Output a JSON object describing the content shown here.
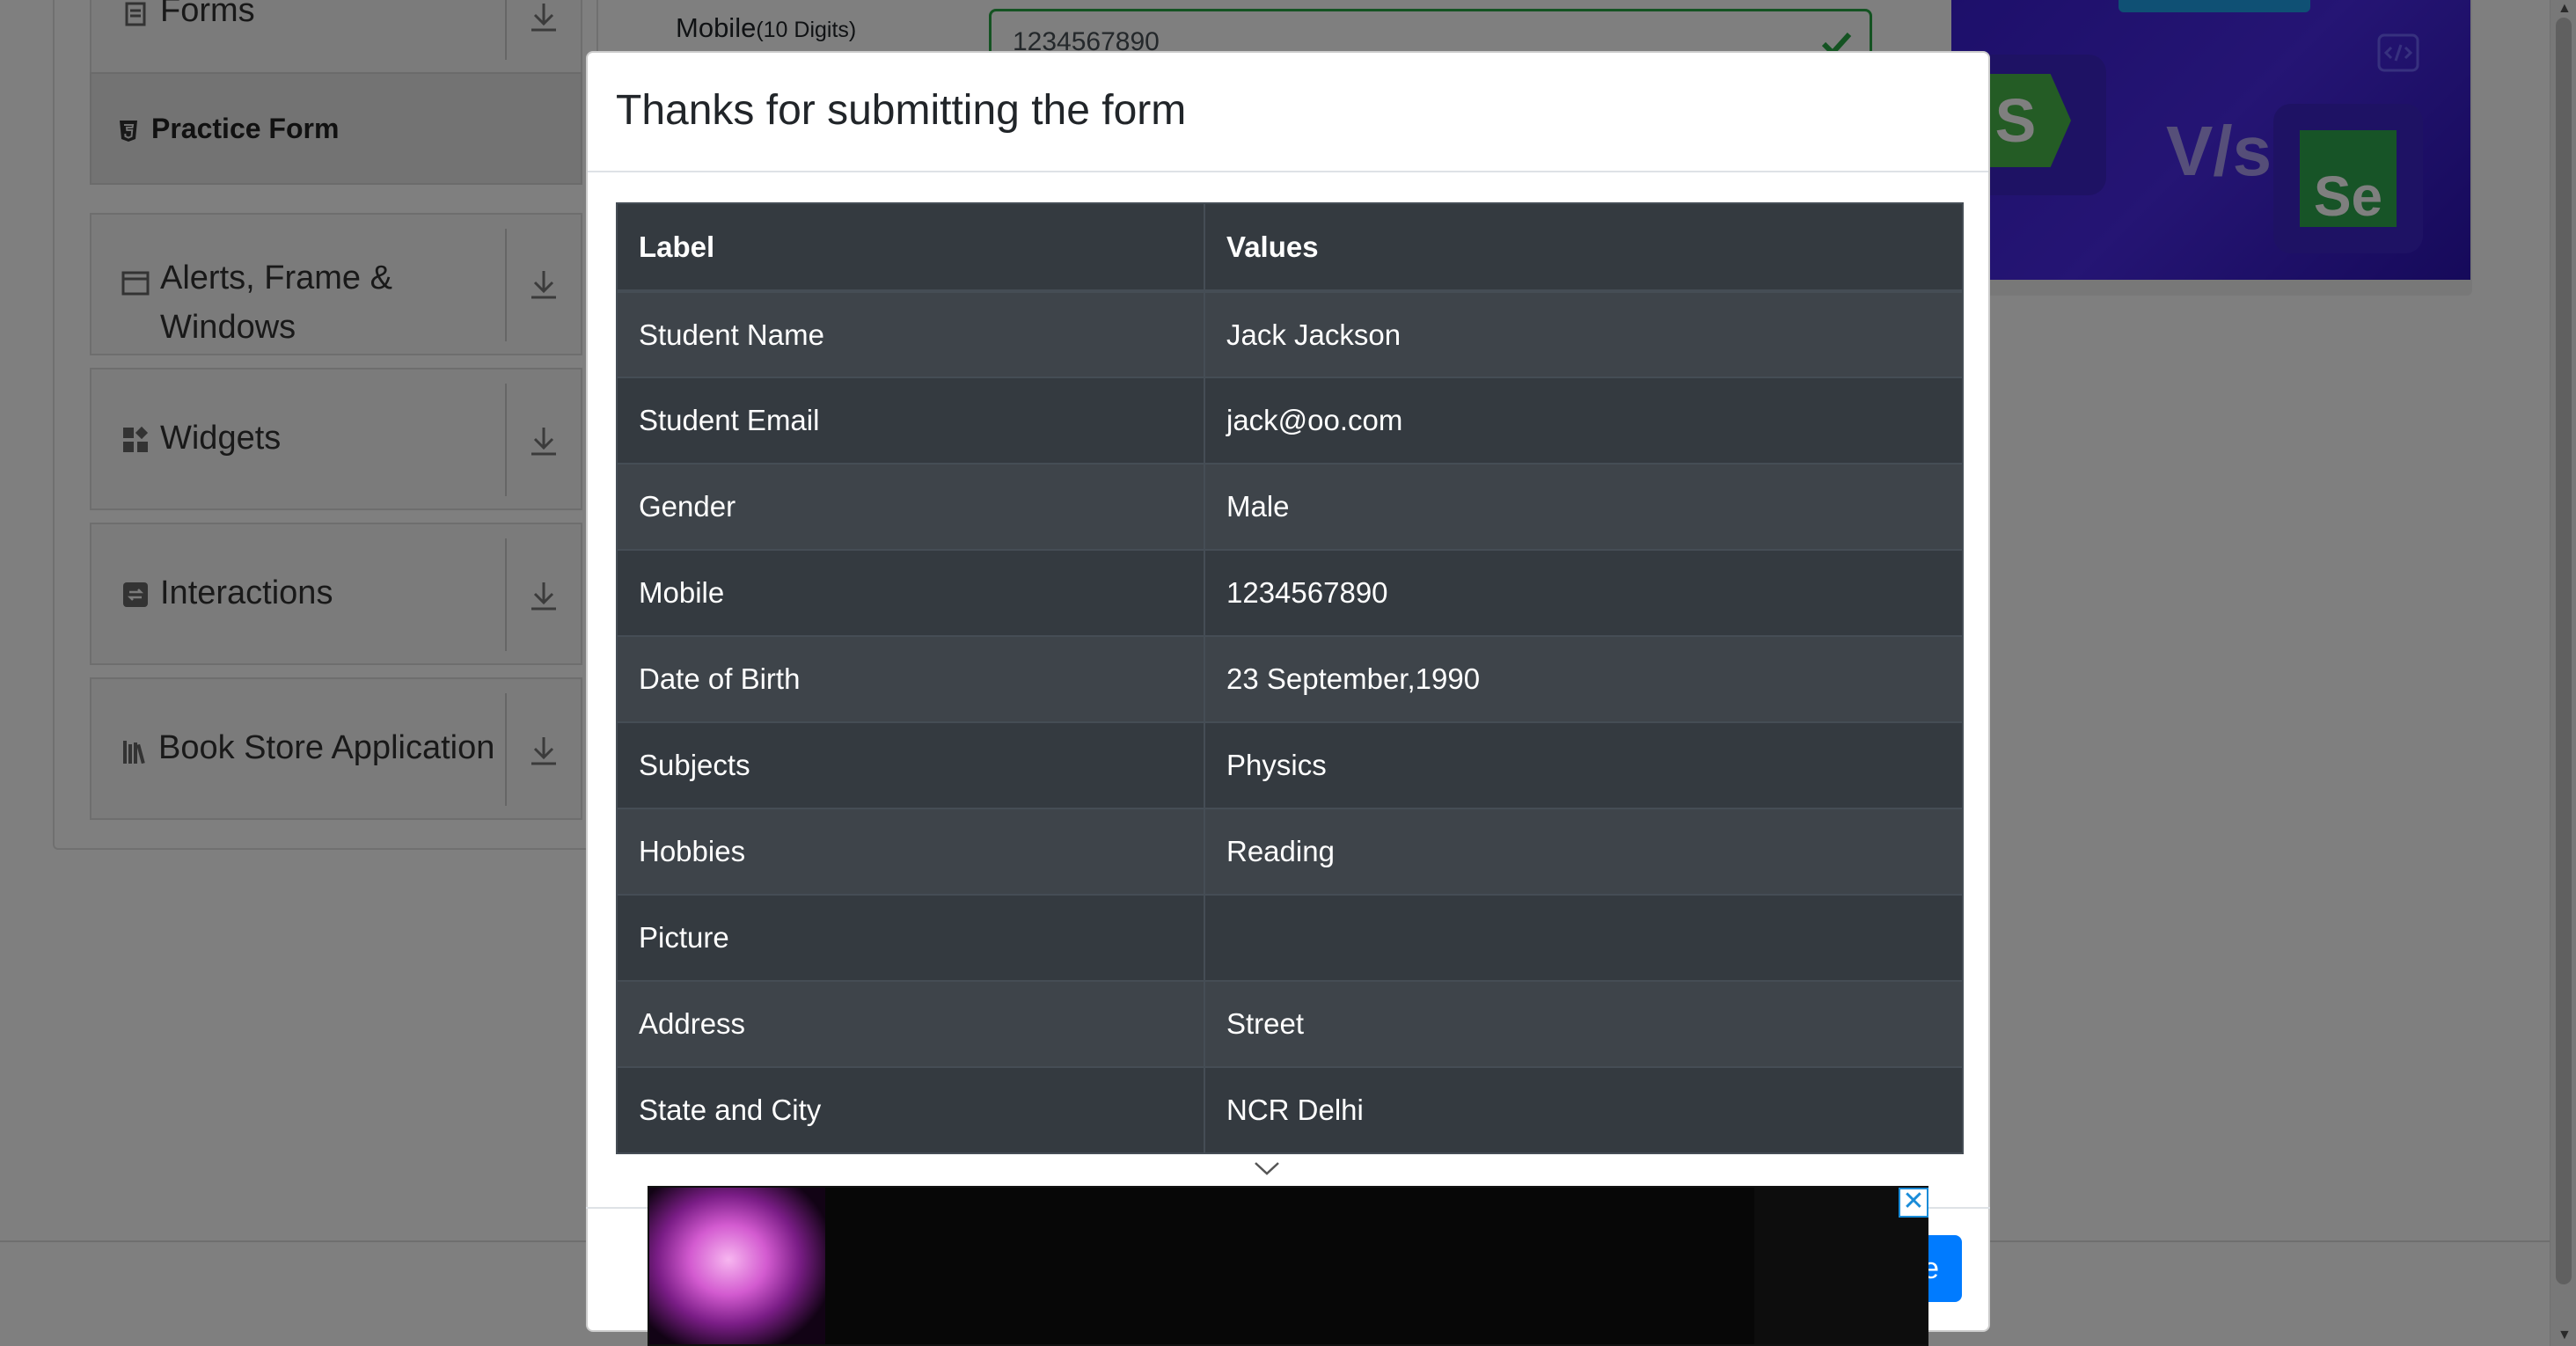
{
  "sidebar": {
    "groups": [
      {
        "label": "Forms",
        "icon": "document-icon"
      },
      {
        "label": "Alerts, Frame &",
        "label_line2": "Windows",
        "icon": "window-icon"
      },
      {
        "label": "Widgets",
        "icon": "widgets-icon"
      },
      {
        "label": "Interactions",
        "icon": "interactions-icon"
      },
      {
        "label": "Book Store Application",
        "icon": "books-icon"
      }
    ],
    "active_item": {
      "label": "Practice Form",
      "icon": "html5-icon"
    }
  },
  "form": {
    "mobile_label": "Mobile",
    "mobile_hint": "(10 Digits)",
    "mobile_value": "1234567890"
  },
  "modal": {
    "title": "Thanks for submitting the form",
    "table": {
      "headers": [
        "Label",
        "Values"
      ],
      "rows": [
        [
          "Student Name",
          "Jack Jackson"
        ],
        [
          "Student Email",
          "jack@oo.com"
        ],
        [
          "Gender",
          "Male"
        ],
        [
          "Mobile",
          "1234567890"
        ],
        [
          "Date of Birth",
          "23 September,1990"
        ],
        [
          "Subjects",
          "Physics"
        ],
        [
          "Hobbies",
          "Reading"
        ],
        [
          "Picture",
          ""
        ],
        [
          "Address",
          "Street"
        ],
        [
          "State and City",
          "NCR Delhi"
        ]
      ]
    },
    "close_label": "e"
  },
  "banner": {
    "left_logo": "S",
    "versus": "V/s",
    "right_logo": "Se"
  },
  "ad": {
    "close_label": "✕"
  },
  "colors": {
    "accent": "#007bff",
    "success": "#28a745",
    "table_dark": "#343a40"
  }
}
